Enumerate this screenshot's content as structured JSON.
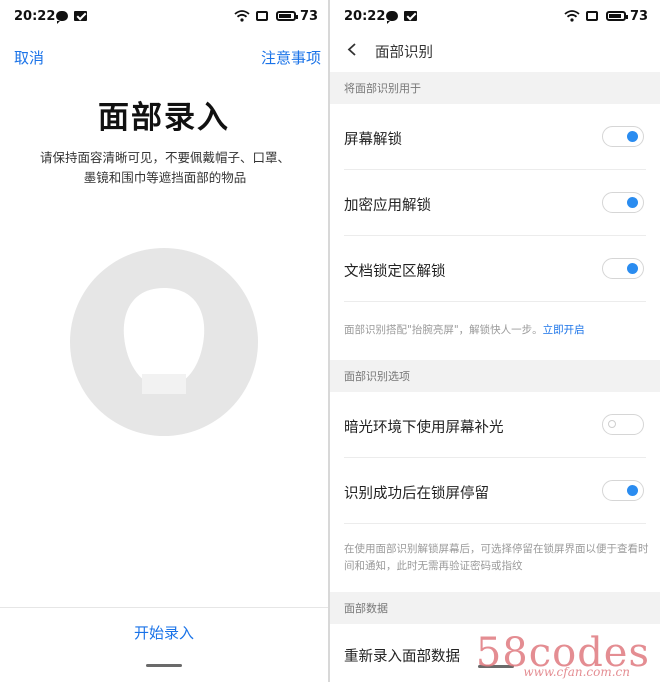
{
  "status_bar": {
    "time": "20:22",
    "battery": "73"
  },
  "left_screen": {
    "cancel_label": "取消",
    "notice_label": "注意事项",
    "title": "面部录入",
    "description": "请保持面容清晰可见，不要佩戴帽子、口罩、墨镜和围巾等遮挡面部的物品",
    "start_label": "开始录入"
  },
  "right_screen": {
    "nav_title": "面部识别",
    "section_use": {
      "header": "将面部识别用于",
      "items": [
        {
          "label": "屏幕解锁",
          "enabled": true
        },
        {
          "label": "加密应用解锁",
          "enabled": true
        },
        {
          "label": "文档锁定区解锁",
          "enabled": true
        }
      ],
      "hint_text": "面部识别搭配\"抬腕亮屏\"，解锁快人一步。",
      "hint_link": "立即开启"
    },
    "section_options": {
      "header": "面部识别选项",
      "items": [
        {
          "label": "暗光环境下使用屏幕补光",
          "enabled": false
        },
        {
          "label": "识别成功后在锁屏停留",
          "enabled": true
        }
      ],
      "hint_text": "在使用面部识别解锁屏幕后，可选择停留在锁屏界面以便于查看时间和通知，此时无需再验证密码或指纹"
    },
    "section_data": {
      "header": "面部数据",
      "partial_item": "重新录入面部数据"
    }
  },
  "watermark": {
    "main": "58codes",
    "sub": "www.cfan.com.cn"
  },
  "colors": {
    "accent": "#1a73e8",
    "toggle_on": "#2a8cf0",
    "section_bg": "#f2f2f2"
  }
}
